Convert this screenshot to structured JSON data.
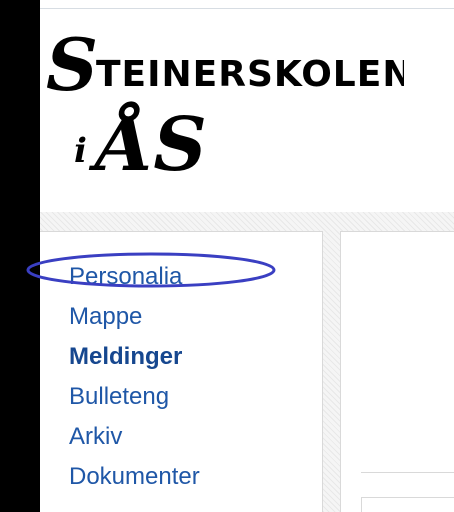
{
  "logo": {
    "line1": "STEINERSKOLEN",
    "line2_prefix": "i",
    "line2_main": "ÅS"
  },
  "sidebar": {
    "items": [
      {
        "label": "Personalia"
      },
      {
        "label": "Mappe"
      },
      {
        "label": "Meldinger"
      },
      {
        "label": "Bulleteng"
      },
      {
        "label": "Arkiv"
      },
      {
        "label": "Dokumenter"
      }
    ],
    "active_item": "Meldinger",
    "highlighted_item": "Personalia"
  },
  "colors": {
    "link": "#1f57a7",
    "link_active": "#16478f",
    "highlight_ellipse": "#3a3fc2",
    "left_bar": "#000000"
  }
}
